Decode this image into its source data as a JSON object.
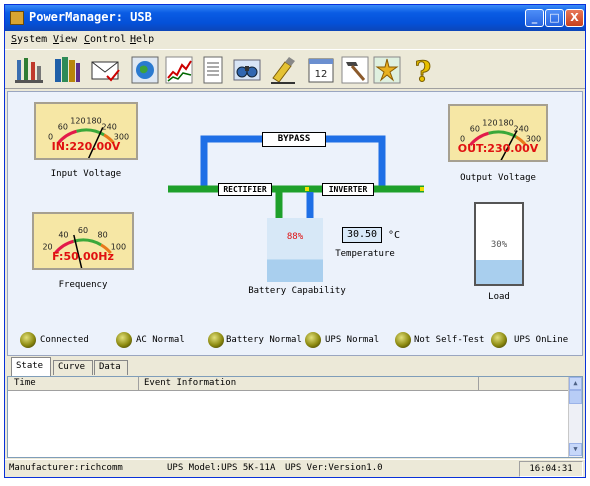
{
  "window": {
    "title": "PowerManager: USB",
    "minimize": "_",
    "maximize": "□",
    "close": "X"
  },
  "menu": [
    {
      "first": "S",
      "rest": "ystem"
    },
    {
      "first": "V",
      "rest": "iew"
    },
    {
      "first": "C",
      "rest": "ontrol"
    },
    {
      "first": "H",
      "rest": "elp"
    }
  ],
  "toolbar_icons": [
    "settings-tools-icon",
    "books-icon",
    "envelope-check-icon",
    "globe-icon",
    "chart-icon",
    "notepad-icon",
    "binoculars-icon",
    "brush-icon",
    "calendar-icon",
    "hammer-icon",
    "wizard-icon",
    "help-icon"
  ],
  "gauges": {
    "input": {
      "label": "Input Voltage",
      "readout": "IN:220.00V",
      "ticks": [
        "0",
        "60",
        "120",
        "180",
        "240",
        "300"
      ],
      "value": 220,
      "max": 300
    },
    "output": {
      "label": "Output Voltage",
      "readout": "OUT:230.00V",
      "ticks": [
        "0",
        "60",
        "120",
        "180",
        "240",
        "300"
      ],
      "value": 230,
      "max": 300
    },
    "frequency": {
      "label": "Frequency",
      "readout": "F:50.00Hz",
      "ticks": [
        "20",
        "40",
        "60",
        "80",
        "100"
      ],
      "value": 50,
      "min": 20,
      "max": 100
    }
  },
  "diagram": {
    "bypass": "BYPASS",
    "rectifier": "RECTIFIER",
    "inverter": "INVERTER",
    "battery_percent": "88%",
    "battery_label": "Battery Capability",
    "battery_level": 0.88,
    "temperature_value": "30.50",
    "temperature_unit": "°C",
    "temperature_label": "Temperature",
    "load_percent": "30%",
    "load_label": "Load",
    "load_level": 0.3
  },
  "indicators": [
    "Connected",
    "AC Normal",
    "Battery Normal",
    "UPS Normal",
    "Not Self-Test",
    "UPS OnLine"
  ],
  "tabs": [
    "State",
    "Curve",
    "Data"
  ],
  "events": {
    "col_time": "Time",
    "col_info": "Event Information"
  },
  "status": {
    "manufacturer": "Manufacturer:richcomm",
    "model": "UPS Model:UPS 5K-11A",
    "version": "UPS Ver:Version1.0",
    "time": "16:04:31"
  },
  "colors": {
    "pipe_blue": "#1e6fe6",
    "pipe_green": "#1ea02a",
    "gauge_face": "#f6e7a5",
    "led": "#8c8a10"
  }
}
